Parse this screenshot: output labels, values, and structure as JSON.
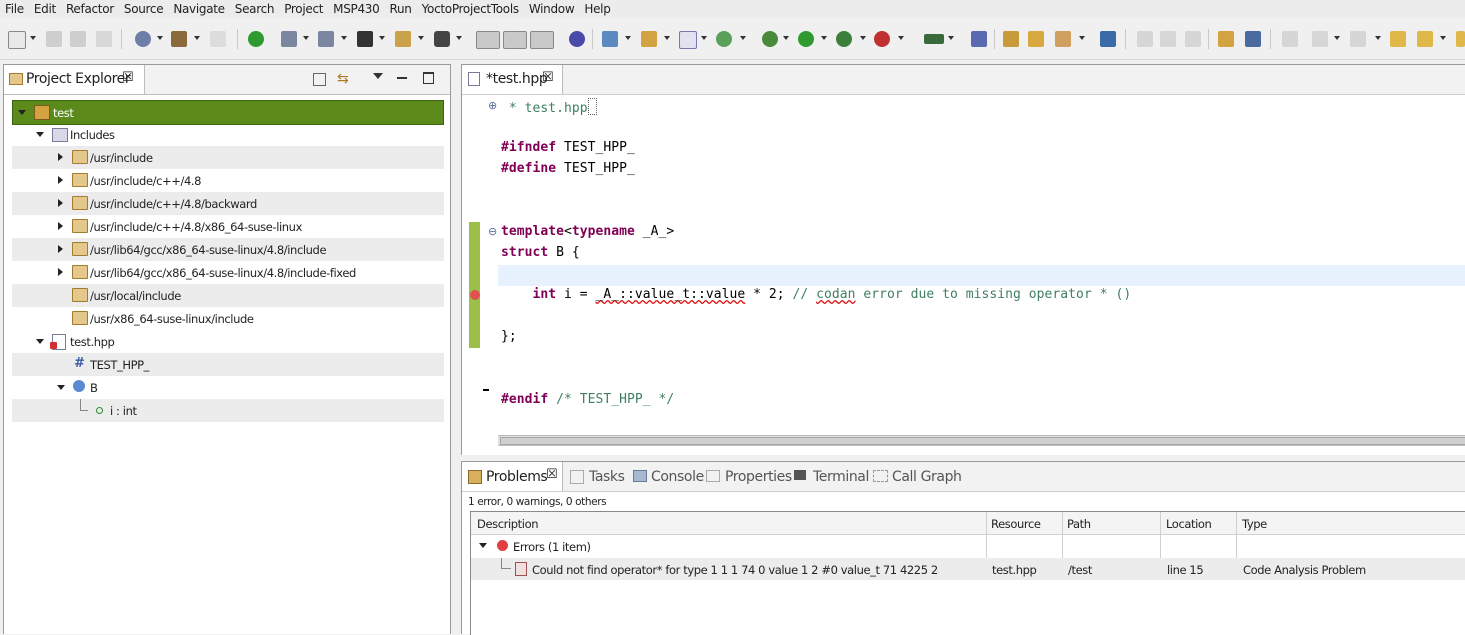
{
  "menu": [
    "File",
    "Edit",
    "Refactor",
    "Source",
    "Navigate",
    "Search",
    "Project",
    "MSP430",
    "Run",
    "YoctoProjectTools",
    "Window",
    "Help"
  ],
  "project_explorer": {
    "tab_title": "Project Explorer",
    "tree": {
      "project": "test",
      "includes_label": "Includes",
      "includes": [
        "/usr/include",
        "/usr/include/c++/4.8",
        "/usr/include/c++/4.8/backward",
        "/usr/include/c++/4.8/x86_64-suse-linux",
        "/usr/lib64/gcc/x86_64-suse-linux/4.8/include",
        "/usr/lib64/gcc/x86_64-suse-linux/4.8/include-fixed",
        "/usr/local/include",
        "/usr/x86_64-suse-linux/include"
      ],
      "file": "test.hpp",
      "macro": "TEST_HPP_",
      "struct": "B",
      "member": "i : int"
    }
  },
  "editor": {
    "tab_title": "*test.hpp",
    "lines": {
      "l1": " * test.hpp",
      "ifndef_kw": "#ifndef",
      "ifndef_rest": " TEST_HPP_",
      "define_kw": "#define",
      "define_rest": " TEST_HPP_",
      "tmpl_kw": "template",
      "tmpl_lt": "<",
      "tmpl_typename": "typename",
      "tmpl_rest": " _A_>",
      "struct_kw": "struct",
      "struct_rest": " B {",
      "int_kw": "int",
      "int_pre": " i = ",
      "int_err": "_A_::value_t::value",
      "int_post": " * 2; ",
      "int_comment_pre": "// ",
      "int_comment_err": "codan",
      "int_comment_post": " error due to missing operator * ()",
      "close": "};",
      "endif_kw": "#endif",
      "endif_comment": " /* TEST_HPP_ */"
    }
  },
  "problems": {
    "tabs": [
      "Problems",
      "Tasks",
      "Console",
      "Properties",
      "Terminal",
      "Call Graph"
    ],
    "summary": "1 error, 0 warnings, 0 others",
    "columns": [
      "Description",
      "Resource",
      "Path",
      "Location",
      "Type"
    ],
    "group": "Errors (1 item)",
    "row": {
      "description": "Could not find operator* for type 1 1 1 74 0 value 1 2 #0 value_t 71 4225 2",
      "resource": "test.hpp",
      "path": "/test",
      "location": "line 15",
      "type": "Code Analysis Problem"
    }
  },
  "colors": {
    "selection": "#5b8a1a",
    "keyword": "#7f0055",
    "comment": "#3f7f5f",
    "error": "#e01010"
  }
}
